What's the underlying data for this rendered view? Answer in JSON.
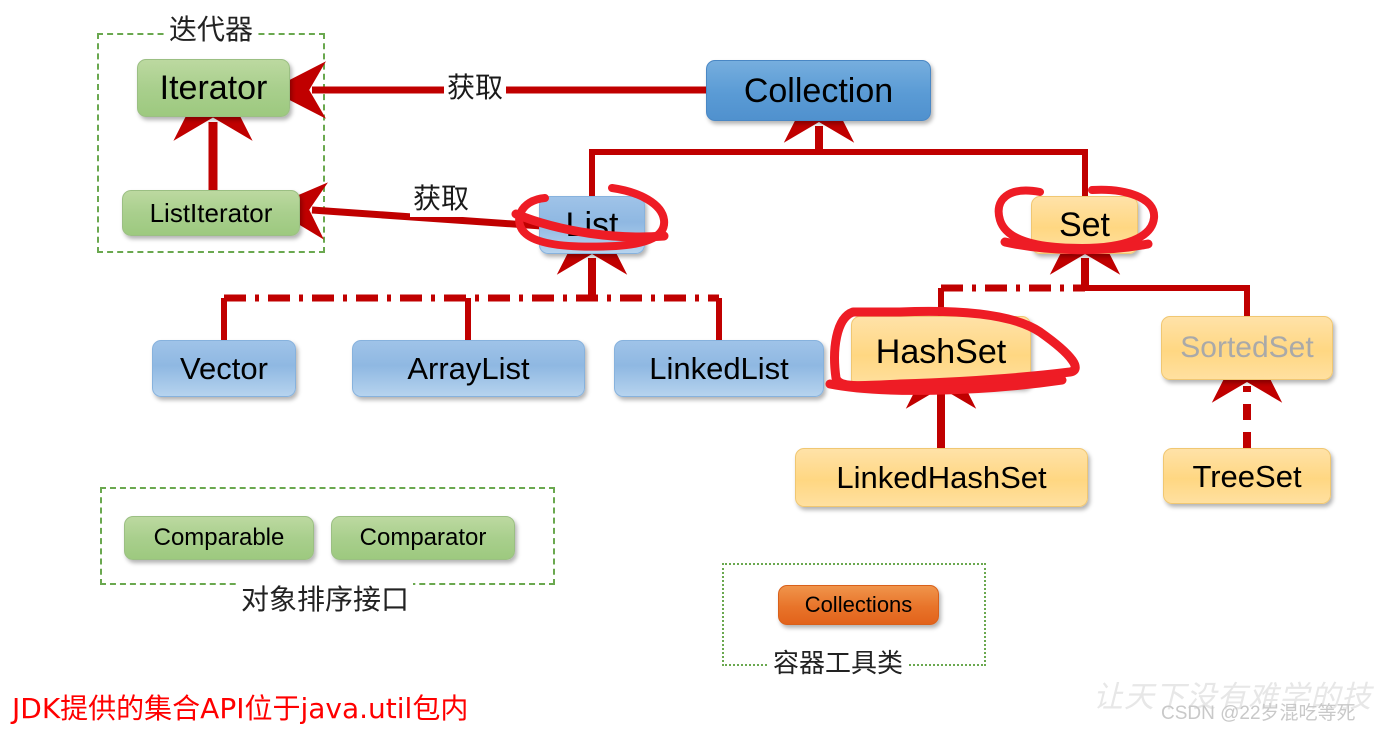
{
  "diagram": {
    "title_note": "JDK提供的集合API位于java.util包内",
    "groups": {
      "iterator_group_label": "迭代器",
      "sorting_group_label": "对象排序接口",
      "tools_group_label": "容器工具类"
    },
    "edge_labels": {
      "collection_to_iterator": "获取",
      "list_to_listiterator": "获取"
    },
    "nodes": {
      "iterator": "Iterator",
      "listiterator": "ListIterator",
      "collection": "Collection",
      "list": "List",
      "set": "Set",
      "vector": "Vector",
      "arraylist": "ArrayList",
      "linkedlist": "LinkedList",
      "hashset": "HashSet",
      "sortedset": "SortedSet",
      "linkedhashset": "LinkedHashSet",
      "treeset": "TreeSet",
      "comparable": "Comparable",
      "comparator": "Comparator",
      "collections": "Collections"
    },
    "colors": {
      "connector_red": "#c00000",
      "highlight_red": "#ee1c25",
      "green_box": "#a9cf8d",
      "blue_box": "#9fc3e8",
      "blue_dark_box": "#5a9bd5",
      "yellow_box": "#ffd782",
      "orange_box": "#e8742a",
      "group_border_green": "#6aa84f",
      "footnote_red": "#ff0000",
      "muted_text": "#a9a9a9"
    },
    "annotations": {
      "highlighted_nodes": [
        "List",
        "Set",
        "HashSet"
      ],
      "style": "hand-drawn red circle"
    },
    "watermark": {
      "attribution": "CSDN @22岁混吃等死",
      "background": "让天下没有难学的技"
    }
  }
}
